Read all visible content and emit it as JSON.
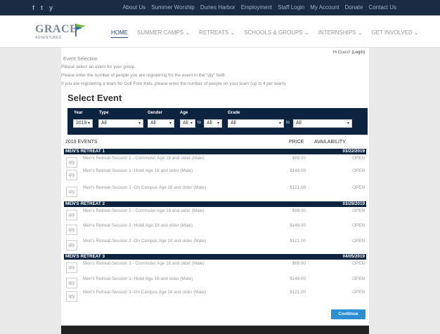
{
  "topbar": {
    "social": [
      "f",
      "t",
      "y"
    ],
    "links": [
      "About Us",
      "Summer Worship",
      "Dunes Harbor",
      "Employment",
      "Staff Login",
      "My Account",
      "Donate",
      "Contact Us"
    ]
  },
  "header": {
    "logo_word": "GRACE",
    "logo_sub": "ADVENTURES",
    "nav": [
      "HOME",
      "SUMMER CAMPS",
      "RETREATS",
      "SCHOOLS & GROUPS",
      "INTERNSHIPS",
      "GET INVOLVED"
    ]
  },
  "page": {
    "greeting": "Hi Guest!",
    "login_link": "(Login)",
    "breadcrumb": "Event Selection",
    "instructions": [
      "Please select an event for your group.",
      "Please enter the number of people you are registering for the event in the \"qty\" field.",
      "If you are registering a team for Golf Fore Kids, please enter the number of people on your team (up to 4 per team)"
    ],
    "title": "Select Event"
  },
  "filters": {
    "labels": {
      "year": "Year",
      "type": "Type",
      "gender": "Gender",
      "age": "Age",
      "grade": "Grade"
    },
    "values": {
      "year": "2019",
      "type": "All",
      "gender": "All",
      "age_from": "All",
      "age_to": "All",
      "grade_from": "All",
      "grade_to": "All"
    },
    "to_label": "to"
  },
  "events": {
    "heading": "2019 EVENTS",
    "price_header": "PRICE",
    "avail_header": "AVAILABILITY",
    "qty_placeholder": "qty",
    "groups": [
      {
        "name": "MEN'S RETREAT 1",
        "date": "03/22/2019",
        "rows": [
          {
            "name": "Men's Retreat-Session 1 - Commuter Age 18 and older (Male)",
            "price": "$89.00",
            "availability": "OPEN"
          },
          {
            "name": "Men's Retreat-Session 1 -Hotel Age 18 and older (Male)",
            "price": "$149.00",
            "availability": "OPEN"
          },
          {
            "name": "Men's Retreat-Session 1 -On Campus Age 18 and older (Male)",
            "price": "$121.00",
            "availability": "OPEN"
          }
        ]
      },
      {
        "name": "MEN'S RETREAT 2",
        "date": "03/29/2019",
        "rows": [
          {
            "name": "Men's Retreat-Session 2 - Commuter Age 18 and older (Male)",
            "price": "$89.00",
            "availability": "OPEN"
          },
          {
            "name": "Men's Retreat-Session 2 -Hotel Age 18 and older (Male)",
            "price": "$149.00",
            "availability": "OPEN"
          },
          {
            "name": "Men's Retreat-Session 2 -On Campus Age 18 and older (Male)",
            "price": "$121.00",
            "availability": "OPEN"
          }
        ]
      },
      {
        "name": "MEN'S RETREAT 3",
        "date": "04/05/2019",
        "rows": [
          {
            "name": "Men's Retreat-Session 3 - Commuter Age 18 and older (Male)",
            "price": "$89.00",
            "availability": "OPEN"
          },
          {
            "name": "Men's Retreat-Session 3 -Hotel Age 18 and older (Male)",
            "price": "$149.00",
            "availability": "OPEN"
          },
          {
            "name": "Men's Retreat-Session 3 -On Campus Age 18 and older (Male)",
            "price": "$121.00",
            "availability": "OPEN"
          }
        ]
      }
    ]
  },
  "actions": {
    "continue_label": "Continue"
  },
  "colors": {
    "navy": "#0c2440",
    "topbar": "#1b2b44",
    "button": "#2c8fd4"
  }
}
